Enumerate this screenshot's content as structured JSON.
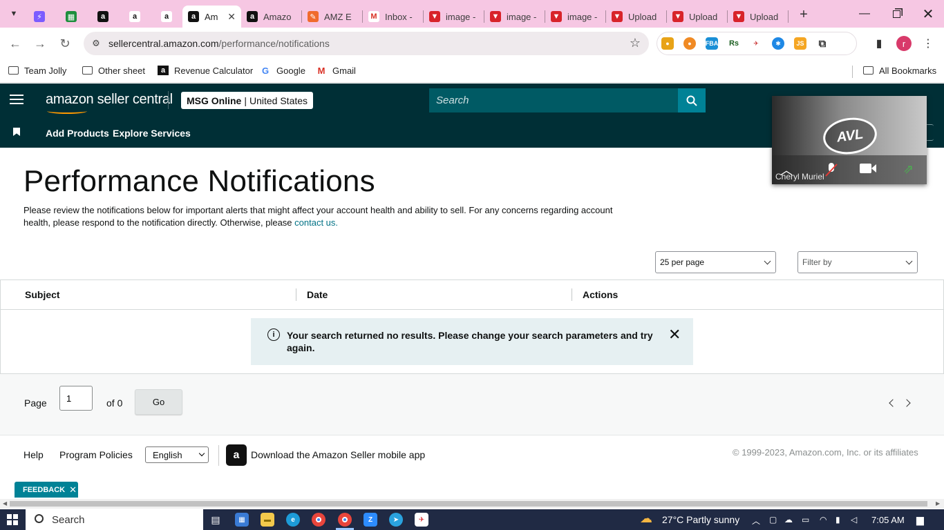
{
  "browser": {
    "tabs": [
      {
        "label": "",
        "icon": "messenger-icon",
        "color": "#7b5cff",
        "pinned": true
      },
      {
        "label": "",
        "icon": "sheets-icon",
        "color": "#1e8e3e",
        "pinned": true
      },
      {
        "label": "",
        "icon": "amazon-a-icon",
        "color": "#111111",
        "pinned": true
      },
      {
        "label": "",
        "icon": "amazon-smile-icon",
        "color": "#ffffff",
        "pinned": true
      },
      {
        "label": "",
        "icon": "amazon-smile-icon",
        "color": "#ffffff",
        "pinned": true
      },
      {
        "label": "Am",
        "icon": "amazon-a-icon",
        "color": "#111111",
        "active": true
      },
      {
        "label": "Amazo",
        "icon": "amazon-a-icon",
        "color": "#111111"
      },
      {
        "label": "AMZ E",
        "icon": "pencil-icon",
        "color": "#f06b2d"
      },
      {
        "label": "Inbox -",
        "icon": "gmail-icon",
        "color": "#ffffff"
      },
      {
        "label": "image -",
        "icon": "triangle-logo-icon",
        "color": "#d8232a"
      },
      {
        "label": "image -",
        "icon": "triangle-logo-icon",
        "color": "#d8232a"
      },
      {
        "label": "image -",
        "icon": "triangle-logo-icon",
        "color": "#d8232a"
      },
      {
        "label": "Upload",
        "icon": "triangle-logo-icon",
        "color": "#d8232a"
      },
      {
        "label": "Upload",
        "icon": "triangle-logo-icon",
        "color": "#d8232a"
      },
      {
        "label": "Upload",
        "icon": "triangle-logo-icon",
        "color": "#d8232a"
      }
    ],
    "url_host": "sellercentral.amazon.com",
    "url_path": "/performance/notifications",
    "profile_initial": "r",
    "bookmarks": [
      {
        "label": "Team Jolly",
        "icon": "folder-icon"
      },
      {
        "label": "Other sheet",
        "icon": "folder-icon"
      },
      {
        "label": "Revenue Calculator",
        "icon": "amazon-a-icon"
      },
      {
        "label": "Google",
        "icon": "google-icon"
      },
      {
        "label": "Gmail",
        "icon": "gmail-icon"
      }
    ],
    "all_bookmarks": "All Bookmarks"
  },
  "header": {
    "logo_text": "amazon seller central",
    "store_name": "MSG Online",
    "store_sep": "|",
    "store_region": "United States",
    "search_placeholder": "Search",
    "nav": [
      "Add Products",
      "Explore Services"
    ]
  },
  "video": {
    "participant": "Cheryl Muriel",
    "logo_text": "AVL"
  },
  "main": {
    "title": "Performance Notifications",
    "intro": "Please review the notifications below for important alerts that might affect your account health and ability to sell. For any concerns regarding account health, please respond to the notification directly. Otherwise, please ",
    "contact_link": "contact us.",
    "per_page": "25 per page",
    "filter": "Filter by",
    "columns": [
      "Subject",
      "Date",
      "Actions"
    ],
    "alert": "Your search returned no results. Please change your search parameters and try again.",
    "pager": {
      "page_label": "Page",
      "page_value": "1",
      "of_label": "of 0",
      "go": "Go"
    }
  },
  "footer": {
    "help": "Help",
    "policies": "Program Policies",
    "language": "English",
    "app_text": "Download the Amazon Seller mobile app",
    "copyright": "© 1999-2023, Amazon.com, Inc. or its affiliates",
    "feedback": "FEEDBACK"
  },
  "taskbar": {
    "search": "Search",
    "weather": "27°C  Partly sunny",
    "time": "7:05 AM"
  }
}
